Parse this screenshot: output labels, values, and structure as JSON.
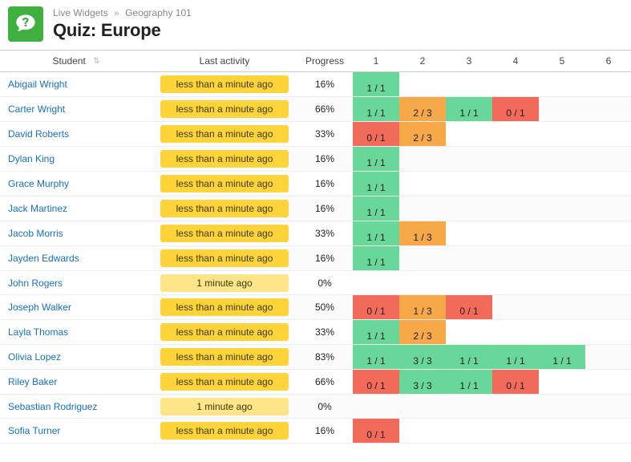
{
  "breadcrumb": {
    "root": "Live Widgets",
    "sep": "»",
    "section": "Geography 101"
  },
  "page_title": "Quiz: Europe",
  "columns": {
    "student": "Student",
    "activity": "Last activity",
    "progress": "Progress",
    "q1": "1",
    "q2": "2",
    "q3": "3",
    "q4": "4",
    "q5": "5",
    "q6": "6"
  },
  "activity": {
    "recent": "less than a minute ago",
    "older": "1 minute ago"
  },
  "students": [
    {
      "name": "Abigail Wright",
      "activity": "recent",
      "progress": "16%",
      "scores": [
        "1 / 1",
        null,
        null,
        null,
        null,
        null
      ],
      "status": [
        "green",
        null,
        null,
        null,
        null,
        null
      ]
    },
    {
      "name": "Carter Wright",
      "activity": "recent",
      "progress": "66%",
      "scores": [
        "1 / 1",
        "2 / 3",
        "1 / 1",
        "0 / 1",
        null,
        null
      ],
      "status": [
        "green",
        "orange",
        "green",
        "red",
        null,
        null
      ]
    },
    {
      "name": "David Roberts",
      "activity": "recent",
      "progress": "33%",
      "scores": [
        "0 / 1",
        "2 / 3",
        null,
        null,
        null,
        null
      ],
      "status": [
        "red",
        "orange",
        null,
        null,
        null,
        null
      ]
    },
    {
      "name": "Dylan King",
      "activity": "recent",
      "progress": "16%",
      "scores": [
        "1 / 1",
        null,
        null,
        null,
        null,
        null
      ],
      "status": [
        "green",
        null,
        null,
        null,
        null,
        null
      ]
    },
    {
      "name": "Grace Murphy",
      "activity": "recent",
      "progress": "16%",
      "scores": [
        "1 / 1",
        null,
        null,
        null,
        null,
        null
      ],
      "status": [
        "green",
        null,
        null,
        null,
        null,
        null
      ]
    },
    {
      "name": "Jack Martinez",
      "activity": "recent",
      "progress": "16%",
      "scores": [
        "1 / 1",
        null,
        null,
        null,
        null,
        null
      ],
      "status": [
        "green",
        null,
        null,
        null,
        null,
        null
      ]
    },
    {
      "name": "Jacob Morris",
      "activity": "recent",
      "progress": "33%",
      "scores": [
        "1 / 1",
        "1 / 3",
        null,
        null,
        null,
        null
      ],
      "status": [
        "green",
        "orange",
        null,
        null,
        null,
        null
      ]
    },
    {
      "name": "Jayden Edwards",
      "activity": "recent",
      "progress": "16%",
      "scores": [
        "1 / 1",
        null,
        null,
        null,
        null,
        null
      ],
      "status": [
        "green",
        null,
        null,
        null,
        null,
        null
      ]
    },
    {
      "name": "John Rogers",
      "activity": "older",
      "progress": "0%",
      "scores": [
        null,
        null,
        null,
        null,
        null,
        null
      ],
      "status": [
        null,
        null,
        null,
        null,
        null,
        null
      ]
    },
    {
      "name": "Joseph Walker",
      "activity": "recent",
      "progress": "50%",
      "scores": [
        "0 / 1",
        "1 / 3",
        "0 / 1",
        null,
        null,
        null
      ],
      "status": [
        "red",
        "orange",
        "red",
        null,
        null,
        null
      ]
    },
    {
      "name": "Layla Thomas",
      "activity": "recent",
      "progress": "33%",
      "scores": [
        "1 / 1",
        "2 / 3",
        null,
        null,
        null,
        null
      ],
      "status": [
        "green",
        "orange",
        null,
        null,
        null,
        null
      ]
    },
    {
      "name": "Olivia Lopez",
      "activity": "recent",
      "progress": "83%",
      "scores": [
        "1 / 1",
        "3 / 3",
        "1 / 1",
        "1 / 1",
        "1 / 1",
        null
      ],
      "status": [
        "green",
        "green",
        "green",
        "green",
        "green",
        null
      ]
    },
    {
      "name": "Riley Baker",
      "activity": "recent",
      "progress": "66%",
      "scores": [
        "0 / 1",
        "3 / 3",
        "1 / 1",
        "0 / 1",
        null,
        null
      ],
      "status": [
        "red",
        "green",
        "green",
        "red",
        null,
        null
      ]
    },
    {
      "name": "Sebastian Rodriguez",
      "activity": "older",
      "progress": "0%",
      "scores": [
        null,
        null,
        null,
        null,
        null,
        null
      ],
      "status": [
        null,
        null,
        null,
        null,
        null,
        null
      ]
    },
    {
      "name": "Sofia Turner",
      "activity": "recent",
      "progress": "16%",
      "scores": [
        "0 / 1",
        null,
        null,
        null,
        null,
        null
      ],
      "status": [
        "red",
        null,
        null,
        null,
        null,
        null
      ]
    }
  ]
}
